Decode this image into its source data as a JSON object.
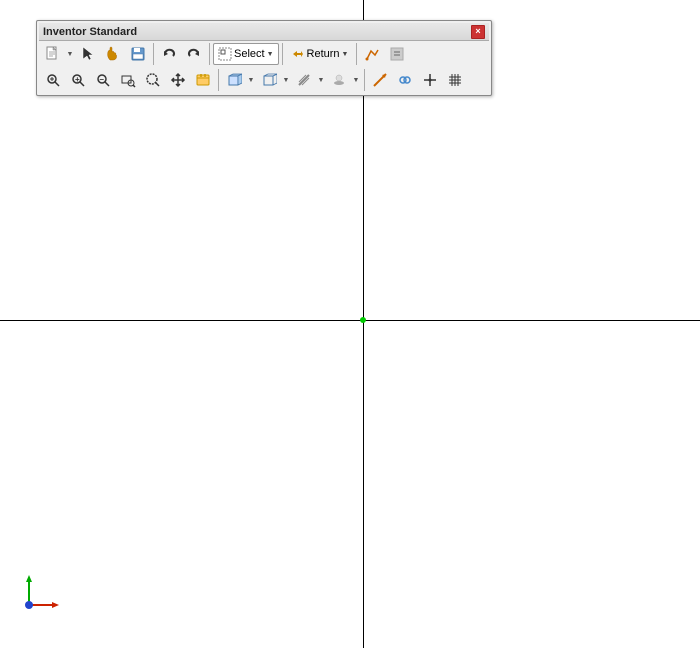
{
  "toolbar": {
    "title": "Inventor Standard",
    "close_label": "×",
    "rows": [
      {
        "items": [
          {
            "name": "new-btn",
            "icon": "new",
            "has_arrow": true
          },
          {
            "name": "select-cursor-btn",
            "icon": "select-cursor",
            "has_arrow": false
          },
          {
            "name": "hand-btn",
            "icon": "hand",
            "has_arrow": false
          },
          {
            "name": "save-btn",
            "icon": "save",
            "has_arrow": false
          },
          {
            "name": "sep1",
            "type": "sep"
          },
          {
            "name": "undo-btn",
            "icon": "undo",
            "has_arrow": false
          },
          {
            "name": "redo-btn",
            "icon": "redo",
            "has_arrow": false
          },
          {
            "name": "sep2",
            "type": "sep"
          },
          {
            "name": "select-dropdown",
            "type": "select",
            "label": "Select"
          },
          {
            "name": "sep3",
            "type": "sep"
          },
          {
            "name": "return-btn",
            "type": "return",
            "label": "Return"
          },
          {
            "name": "sep4",
            "type": "sep"
          },
          {
            "name": "sketch-btn",
            "icon": "sketch"
          },
          {
            "name": "gray-btn",
            "icon": "gray"
          }
        ]
      },
      {
        "items": [
          {
            "name": "zoom-fit-btn",
            "icon": "zoom-fit"
          },
          {
            "name": "zoom-in-btn",
            "icon": "zoom-in"
          },
          {
            "name": "zoom-out-btn",
            "icon": "zoom-out"
          },
          {
            "name": "zoom-window-btn",
            "icon": "zoom-window"
          },
          {
            "name": "zoom-selected-btn",
            "icon": "zoom-selected"
          },
          {
            "name": "pan-btn",
            "icon": "pan"
          },
          {
            "name": "calendar-btn",
            "icon": "calendar"
          },
          {
            "name": "sep5",
            "type": "sep"
          },
          {
            "name": "box-btn",
            "icon": "box",
            "has_arrow": true
          },
          {
            "name": "box2-btn",
            "icon": "box2",
            "has_arrow": true
          },
          {
            "name": "slash-btn",
            "icon": "slash",
            "has_arrow": true
          },
          {
            "name": "dots-btn",
            "icon": "dots",
            "has_arrow": true
          },
          {
            "name": "sep6",
            "type": "sep"
          },
          {
            "name": "arrow-btn",
            "icon": "arrow"
          },
          {
            "name": "chain-btn",
            "icon": "chain"
          },
          {
            "name": "center-btn",
            "icon": "center"
          },
          {
            "name": "hash-btn",
            "icon": "hash"
          }
        ]
      }
    ]
  },
  "canvas": {
    "bg_color": "#ffffff",
    "crosshair_color": "#000000",
    "center_dot_color": "#00cc00"
  },
  "axis": {
    "x_color": "#cc2200",
    "y_color": "#00aa00",
    "z_color": "#0000cc"
  }
}
